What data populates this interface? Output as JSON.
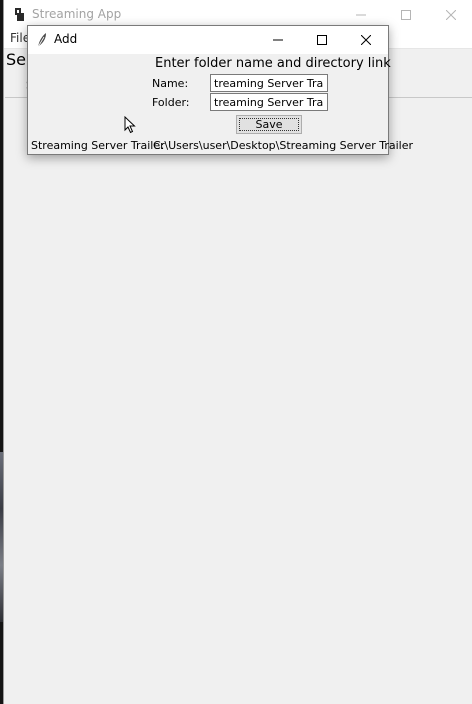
{
  "main_window": {
    "title": "Streaming App",
    "menu": {
      "file": "File"
    },
    "partial_label": "Sel",
    "partial_tab": "S",
    "buttons": {
      "minimize": "—",
      "maximize": "☐",
      "close": "✕"
    }
  },
  "dialog": {
    "title": "Add",
    "heading": "Enter folder name and directory link",
    "name_label": "Name:",
    "name_value": "treaming Server Trailer",
    "folder_label": "Folder:",
    "folder_value": "treaming Server Trailer",
    "save_label": "Save",
    "result_name": "Streaming Server Trailer",
    "result_path": "C:\\Users\\user\\Desktop\\Streaming Server Trailer",
    "buttons": {
      "minimize": "—",
      "maximize": "☐",
      "close": "✕"
    }
  }
}
